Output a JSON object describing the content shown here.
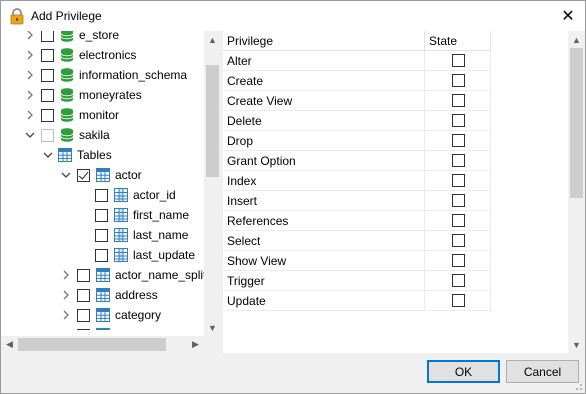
{
  "dialog": {
    "title": "Add Privilege",
    "close_glyph": "✕"
  },
  "tree": {
    "items": [
      {
        "label": "e_store",
        "type": "database",
        "arrow": "collapsed",
        "checkbox": "unchecked",
        "level": 0
      },
      {
        "label": "electronics",
        "type": "database",
        "arrow": "collapsed",
        "checkbox": "unchecked",
        "level": 0
      },
      {
        "label": "information_schema",
        "type": "database",
        "arrow": "collapsed",
        "checkbox": "unchecked",
        "level": 0
      },
      {
        "label": "moneyrates",
        "type": "database",
        "arrow": "collapsed",
        "checkbox": "unchecked",
        "level": 0
      },
      {
        "label": "monitor",
        "type": "database",
        "arrow": "collapsed",
        "checkbox": "unchecked",
        "level": 0
      },
      {
        "label": "sakila",
        "type": "database",
        "arrow": "expanded",
        "checkbox": "disabled",
        "level": 0
      },
      {
        "label": "Tables",
        "type": "tables-folder",
        "arrow": "expanded",
        "checkbox": "none",
        "level": 1
      },
      {
        "label": "actor",
        "type": "table",
        "arrow": "expanded",
        "checkbox": "checked",
        "level": 2
      },
      {
        "label": "actor_id",
        "type": "column",
        "arrow": "none",
        "checkbox": "unchecked",
        "level": 3
      },
      {
        "label": "first_name",
        "type": "column",
        "arrow": "none",
        "checkbox": "unchecked",
        "level": 3
      },
      {
        "label": "last_name",
        "type": "column",
        "arrow": "none",
        "checkbox": "unchecked",
        "level": 3
      },
      {
        "label": "last_update",
        "type": "column",
        "arrow": "none",
        "checkbox": "unchecked",
        "level": 3
      },
      {
        "label": "actor_name_split",
        "type": "table",
        "arrow": "collapsed",
        "checkbox": "unchecked",
        "level": 2
      },
      {
        "label": "address",
        "type": "table",
        "arrow": "collapsed",
        "checkbox": "unchecked",
        "level": 2
      },
      {
        "label": "category",
        "type": "table",
        "arrow": "collapsed",
        "checkbox": "unchecked",
        "level": 2
      },
      {
        "label": "city",
        "type": "table",
        "arrow": "collapsed",
        "checkbox": "unchecked",
        "level": 2
      }
    ]
  },
  "grid": {
    "headers": {
      "privilege": "Privilege",
      "state": "State"
    },
    "rows": [
      {
        "privilege": "Alter",
        "state": false
      },
      {
        "privilege": "Create",
        "state": false
      },
      {
        "privilege": "Create View",
        "state": false
      },
      {
        "privilege": "Delete",
        "state": false
      },
      {
        "privilege": "Drop",
        "state": false
      },
      {
        "privilege": "Grant Option",
        "state": false
      },
      {
        "privilege": "Index",
        "state": false
      },
      {
        "privilege": "Insert",
        "state": false
      },
      {
        "privilege": "References",
        "state": false
      },
      {
        "privilege": "Select",
        "state": false
      },
      {
        "privilege": "Show View",
        "state": false
      },
      {
        "privilege": "Trigger",
        "state": false
      },
      {
        "privilege": "Update",
        "state": false
      }
    ]
  },
  "buttons": {
    "ok": "OK",
    "cancel": "Cancel"
  },
  "colors": {
    "database_icon": "#2e9e3a",
    "table_icon": "#2f7fc1",
    "lock_icon": "#e8a317",
    "default_button_border": "#0078d7"
  },
  "icons": {
    "lock": "lock-icon",
    "database": "database-icon",
    "table": "table-icon",
    "column": "column-icon"
  }
}
